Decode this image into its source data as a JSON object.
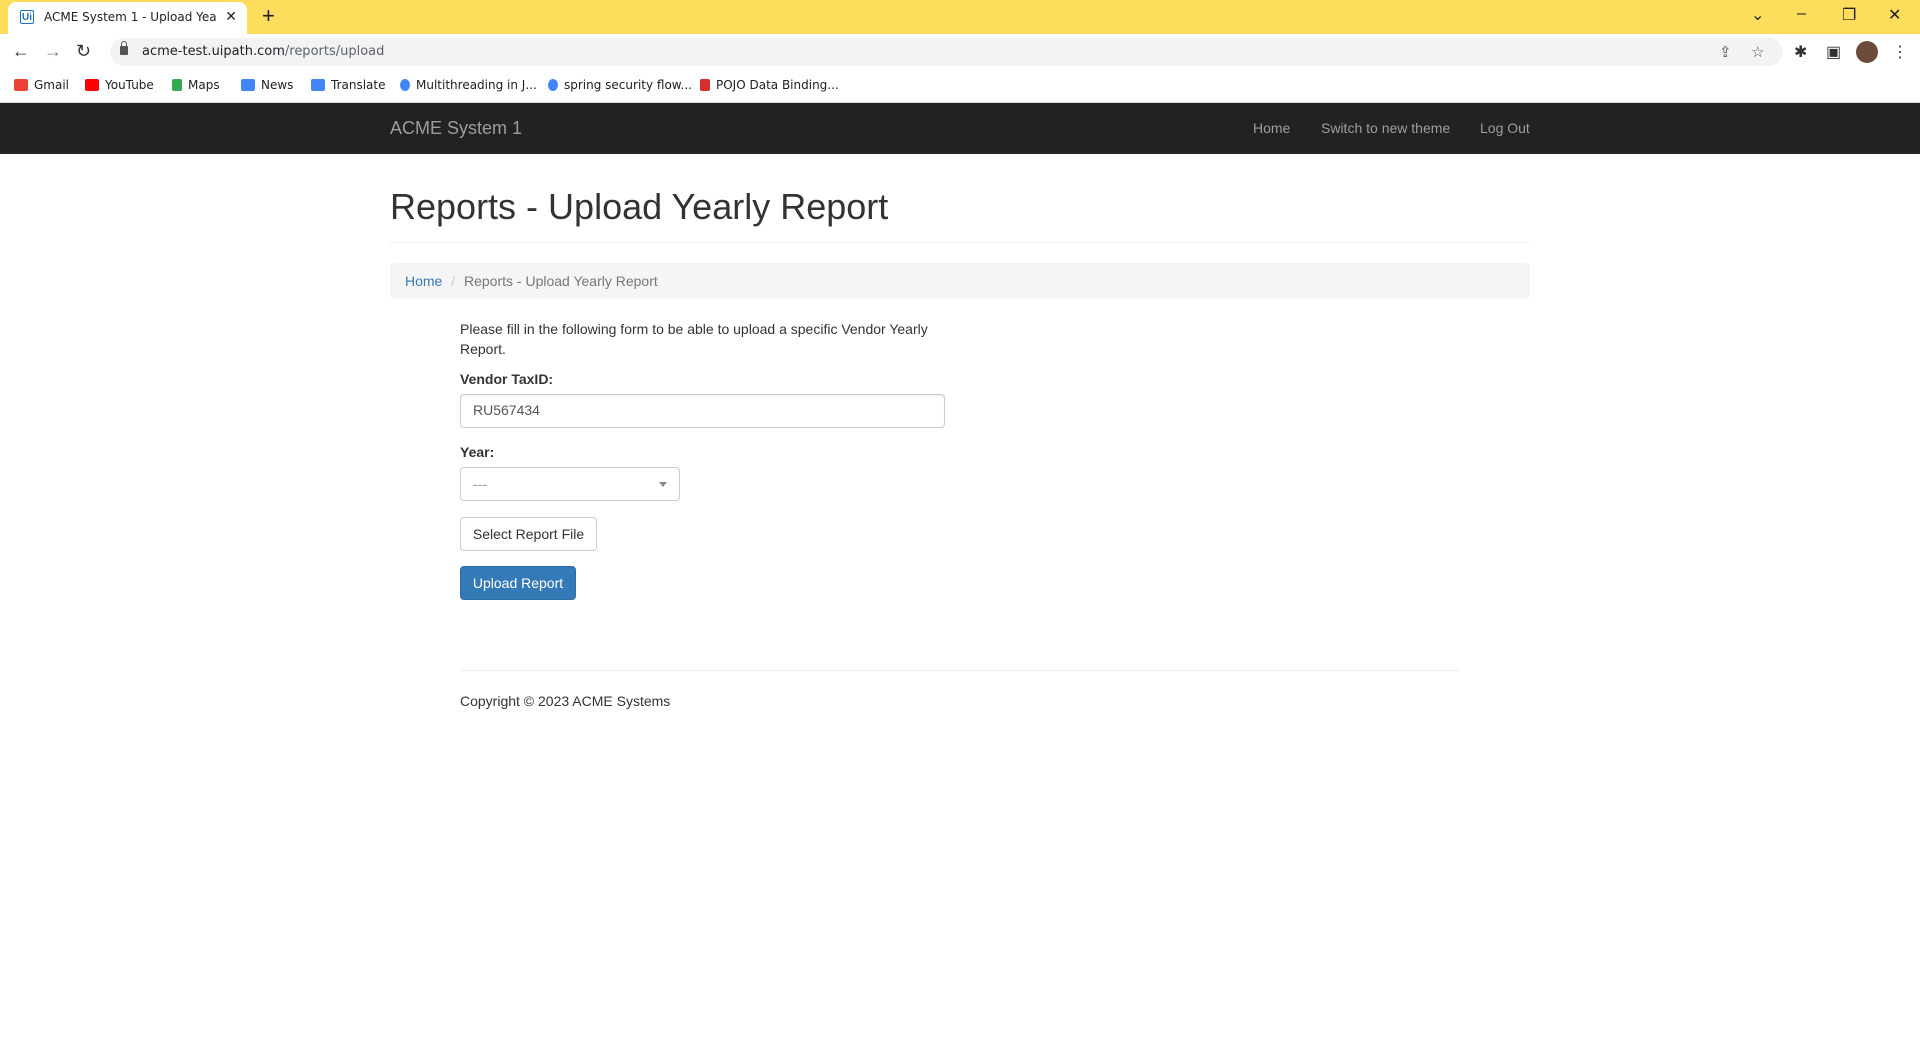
{
  "browser": {
    "tab_title": "ACME System 1 - Upload Yearly Report",
    "tab_favicon": "Ui",
    "url_host": "acme-test.uipath.com",
    "url_path": "/reports/upload",
    "bookmarks": [
      {
        "label": "Gmail",
        "icon": "gmail-icon",
        "color": "#ea4335"
      },
      {
        "label": "YouTube",
        "icon": "youtube-icon",
        "color": "#ff0000"
      },
      {
        "label": "Maps",
        "icon": "maps-icon",
        "color": "#34a853"
      },
      {
        "label": "News",
        "icon": "news-icon",
        "color": "#4285f4"
      },
      {
        "label": "Translate",
        "icon": "translate-icon",
        "color": "#4285f4"
      },
      {
        "label": "Multithreading in J...",
        "icon": "g-icon",
        "color": "#4285f4"
      },
      {
        "label": "spring security flow...",
        "icon": "google-icon",
        "color": "#4285f4"
      },
      {
        "label": "POJO Data Binding...",
        "icon": "pojo-icon",
        "color": "#d32f2f"
      }
    ]
  },
  "site": {
    "brand": "ACME System 1",
    "nav": {
      "home": "Home",
      "switch_theme": "Switch to new theme",
      "logout": "Log Out"
    }
  },
  "page": {
    "title": "Reports - Upload Yearly Report",
    "breadcrumb": {
      "home": "Home",
      "separator": "/",
      "current": "Reports - Upload Yearly Report"
    },
    "intro": "Please fill in the following form to be able to upload a specific Vendor Yearly Report.",
    "form": {
      "vendor_label": "Vendor TaxID:",
      "vendor_value": "RU567434",
      "year_label": "Year:",
      "year_value": "---",
      "select_file_button": "Select Report File",
      "upload_button": "Upload Report"
    },
    "footer": "Copyright © 2023 ACME Systems"
  },
  "colors": {
    "tabstrip": "#fedd5d",
    "navbar": "#222222",
    "link": "#337ab7",
    "primary_button": "#337ab7"
  }
}
